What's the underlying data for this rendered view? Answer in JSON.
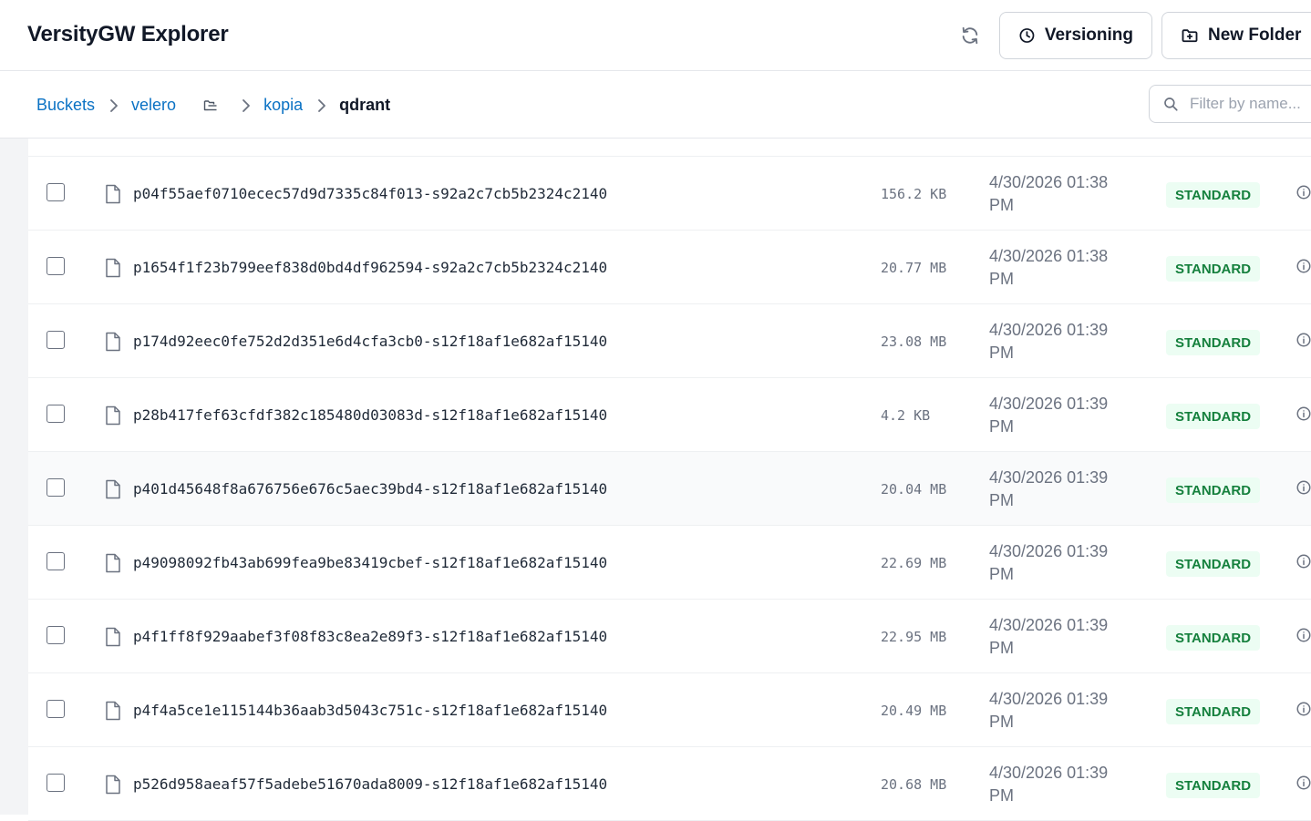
{
  "app": {
    "title": "VersityGW Explorer"
  },
  "header": {
    "refresh_icon": "refresh-icon",
    "versioning_label": "Versioning",
    "new_folder_label": "New Folder"
  },
  "breadcrumb": {
    "items": [
      "Buckets",
      "velero",
      "kopia",
      "qdrant"
    ]
  },
  "filter": {
    "placeholder": "Filter by name..."
  },
  "colors": {
    "link": "#0b72c4",
    "badge_text": "#15803d",
    "badge_bg": "#ecfdf3",
    "sidebar_bg": "#f3f4f6"
  },
  "files": [
    {
      "name": "p04f55aef0710ecec57d9d7335c84f013-s92a2c7cb5b2324c2140",
      "size": "156.2 KB",
      "date": "4/30/2026 01:38 PM",
      "storage_class": "STANDARD"
    },
    {
      "name": "p1654f1f23b799eef838d0bd4df962594-s92a2c7cb5b2324c2140",
      "size": "20.77 MB",
      "date": "4/30/2026 01:38 PM",
      "storage_class": "STANDARD"
    },
    {
      "name": "p174d92eec0fe752d2d351e6d4cfa3cb0-s12f18af1e682af15140",
      "size": "23.08 MB",
      "date": "4/30/2026 01:39 PM",
      "storage_class": "STANDARD"
    },
    {
      "name": "p28b417fef63cfdf382c185480d03083d-s12f18af1e682af15140",
      "size": "4.2 KB",
      "date": "4/30/2026 01:39 PM",
      "storage_class": "STANDARD"
    },
    {
      "name": "p401d45648f8a676756e676c5aec39bd4-s12f18af1e682af15140",
      "size": "20.04 MB",
      "date": "4/30/2026 01:39 PM",
      "storage_class": "STANDARD"
    },
    {
      "name": "p49098092fb43ab699fea9be83419cbef-s12f18af1e682af15140",
      "size": "22.69 MB",
      "date": "4/30/2026 01:39 PM",
      "storage_class": "STANDARD"
    },
    {
      "name": "p4f1ff8f929aabef3f08f83c8ea2e89f3-s12f18af1e682af15140",
      "size": "22.95 MB",
      "date": "4/30/2026 01:39 PM",
      "storage_class": "STANDARD"
    },
    {
      "name": "p4f4a5ce1e115144b36aab3d5043c751c-s12f18af1e682af15140",
      "size": "20.49 MB",
      "date": "4/30/2026 01:39 PM",
      "storage_class": "STANDARD"
    },
    {
      "name": "p526d958aeaf57f5adebe51670ada8009-s12f18af1e682af15140",
      "size": "20.68 MB",
      "date": "4/30/2026 01:39 PM",
      "storage_class": "STANDARD"
    }
  ]
}
